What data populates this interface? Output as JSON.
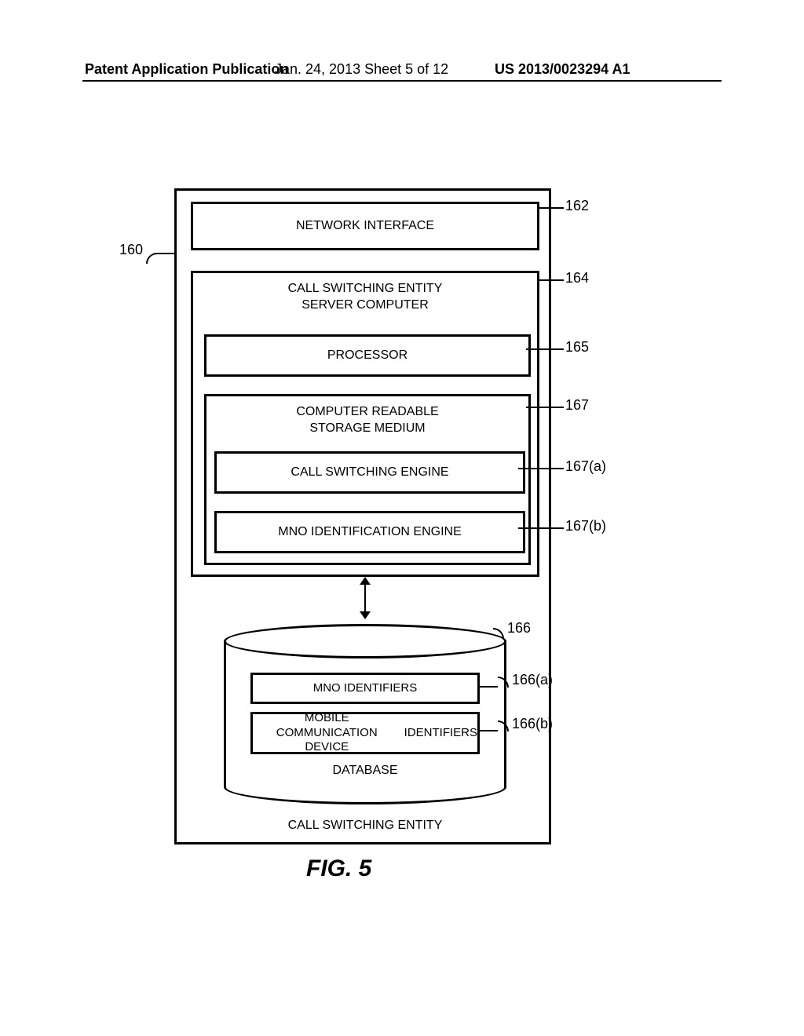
{
  "header": {
    "left": "Patent Application Publication",
    "mid": "Jan. 24, 2013  Sheet 5 of 12",
    "right": "US 2013/0023294 A1"
  },
  "refs": {
    "r160": "160",
    "r162": "162",
    "r164": "164",
    "r165": "165",
    "r167": "167",
    "r167a": "167(a)",
    "r167b": "167(b)",
    "r166": "166",
    "r166a": "166(a)",
    "r166b": "166(b)"
  },
  "labels": {
    "network_interface": "NETWORK INTERFACE",
    "server_computer_l1": "CALL SWITCHING ENTITY",
    "server_computer_l2": "SERVER COMPUTER",
    "processor": "PROCESSOR",
    "crsm_l1": "COMPUTER READABLE",
    "crsm_l2": "STORAGE MEDIUM",
    "call_switching_engine": "CALL SWITCHING ENGINE",
    "mno_id_engine": "MNO IDENTIFICATION ENGINE",
    "mno_identifiers": "MNO IDENTIFIERS",
    "mcd_ids_l1": "MOBILE COMMUNICATION DEVICE",
    "mcd_ids_l2": "IDENTIFIERS",
    "database": "DATABASE",
    "call_switching_entity": "CALL SWITCHING ENTITY",
    "figure": "FIG. 5"
  }
}
